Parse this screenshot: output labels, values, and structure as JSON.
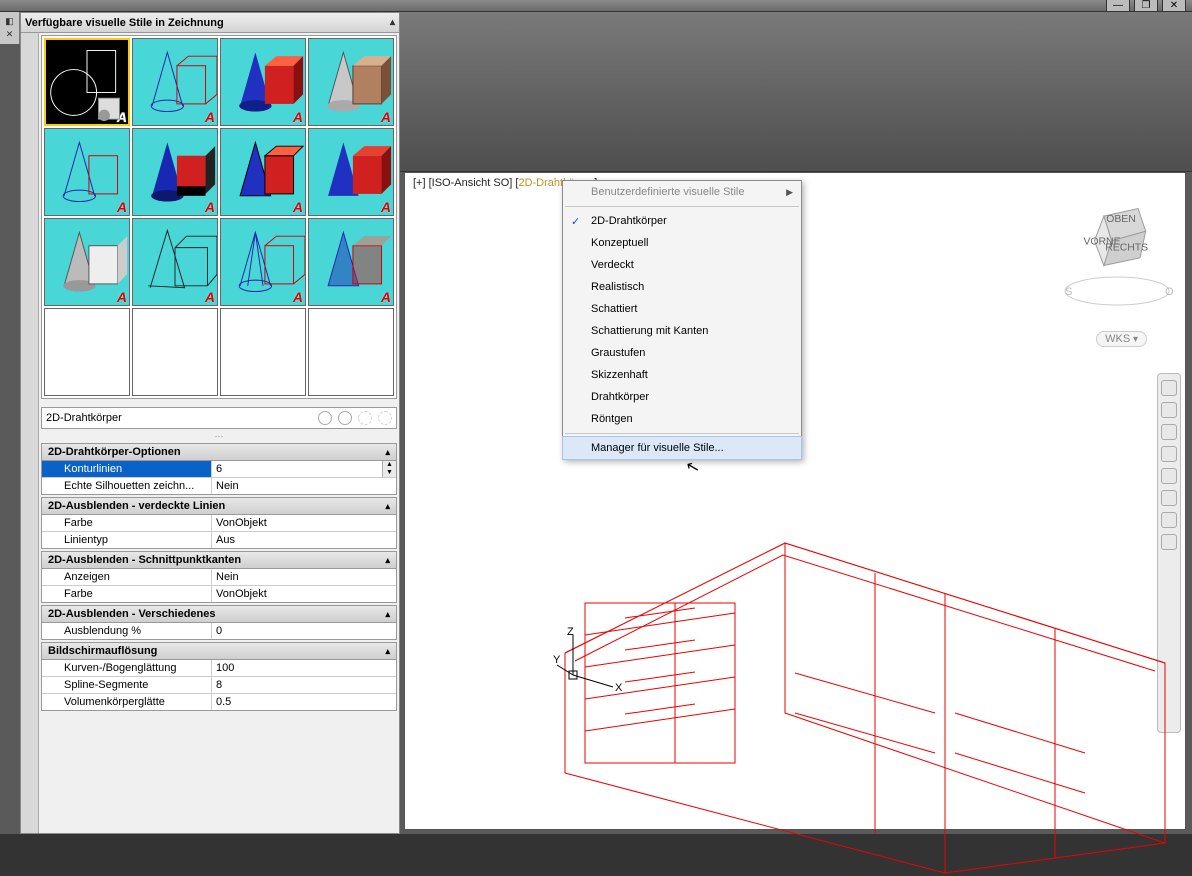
{
  "window": {
    "minimize": "—",
    "restore": "❐",
    "close": "✕"
  },
  "palette": {
    "title": "Verfügbare visuelle Stile in Zeichnung",
    "current_style": "2D-Drahtkörper",
    "sections": {
      "s1": {
        "header": "2D-Drahtkörper-Optionen",
        "rows": [
          {
            "k": "Konturlinien",
            "v": "6",
            "sel": true,
            "spin": true
          },
          {
            "k": "Echte Silhouetten zeichn...",
            "v": "Nein"
          }
        ]
      },
      "s2": {
        "header": "2D-Ausblenden - verdeckte Linien",
        "rows": [
          {
            "k": "Farbe",
            "v": "VonObjekt"
          },
          {
            "k": "Linientyp",
            "v": "Aus"
          }
        ]
      },
      "s3": {
        "header": "2D-Ausblenden - Schnittpunktkanten",
        "rows": [
          {
            "k": "Anzeigen",
            "v": "Nein"
          },
          {
            "k": "Farbe",
            "v": "VonObjekt"
          }
        ]
      },
      "s4": {
        "header": "2D-Ausblenden - Verschiedenes",
        "rows": [
          {
            "k": "Ausblendung %",
            "v": "0"
          }
        ]
      },
      "s5": {
        "header": "Bildschirmauflösung",
        "rows": [
          {
            "k": "Kurven-/Bogenglättung",
            "v": "100"
          },
          {
            "k": "Spline-Segmente",
            "v": "8"
          },
          {
            "k": "Volumenkörperglätte",
            "v": "0.5"
          }
        ]
      }
    }
  },
  "viewport": {
    "label_prefix": "[+] [ISO-Ansicht SO] [",
    "label_style": "2D-Drahtkörper",
    "label_suffix": "]",
    "wks": "WKS",
    "cube": {
      "top": "OBEN",
      "front": "VORNE",
      "right": "RECHTS"
    }
  },
  "context_menu": {
    "items": [
      {
        "label": "Benutzerdefinierte visuelle Stile",
        "disabled": true,
        "sub": true
      },
      {
        "sep": true
      },
      {
        "label": "2D-Drahtkörper",
        "checked": true
      },
      {
        "label": "Konzeptuell"
      },
      {
        "label": "Verdeckt"
      },
      {
        "label": "Realistisch"
      },
      {
        "label": "Schattiert"
      },
      {
        "label": "Schattierung mit Kanten"
      },
      {
        "label": "Graustufen"
      },
      {
        "label": "Skizzenhaft"
      },
      {
        "label": "Drahtkörper"
      },
      {
        "label": "Röntgen"
      },
      {
        "sep": true
      },
      {
        "label": "Manager für visuelle Stile...",
        "hover": true
      }
    ]
  }
}
